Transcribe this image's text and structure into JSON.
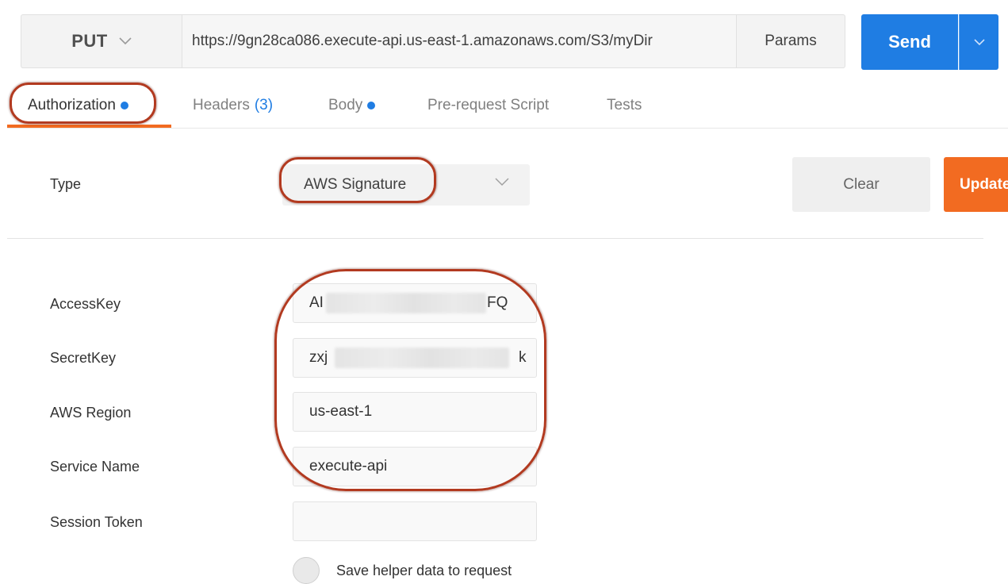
{
  "request": {
    "method": "PUT",
    "url": "https://9gn28ca086.execute-api.us-east-1.amazonaws.com/S3/myDir",
    "params_label": "Params",
    "send_label": "Send"
  },
  "tabs": [
    {
      "label": "Authorization",
      "indicator": "dot"
    },
    {
      "label": "Headers",
      "count": "(3)"
    },
    {
      "label": "Body",
      "indicator": "dot"
    },
    {
      "label": "Pre-request Script"
    },
    {
      "label": "Tests"
    }
  ],
  "auth": {
    "type_label": "Type",
    "type_value": "AWS Signature",
    "clear_label": "Clear",
    "update_label": "Update"
  },
  "fields": {
    "access_key": {
      "label": "AccessKey",
      "prefix": "AI",
      "suffix": "FQ"
    },
    "secret_key": {
      "label": "SecretKey",
      "prefix": "zxj",
      "suffix": "k"
    },
    "aws_region": {
      "label": "AWS Region",
      "value": "us-east-1"
    },
    "service_name": {
      "label": "Service Name",
      "value": "execute-api"
    },
    "session_token": {
      "label": "Session Token",
      "value": ""
    }
  },
  "save_helper_label": "Save helper data to request",
  "colors": {
    "accent_blue": "#1f7de3",
    "accent_orange": "#f26b21",
    "annotation_red": "#b23a20"
  },
  "icons": {
    "method_dropdown": "chevron-down-icon",
    "send_dropdown": "chevron-down-icon",
    "type_dropdown": "chevron-down-icon"
  }
}
